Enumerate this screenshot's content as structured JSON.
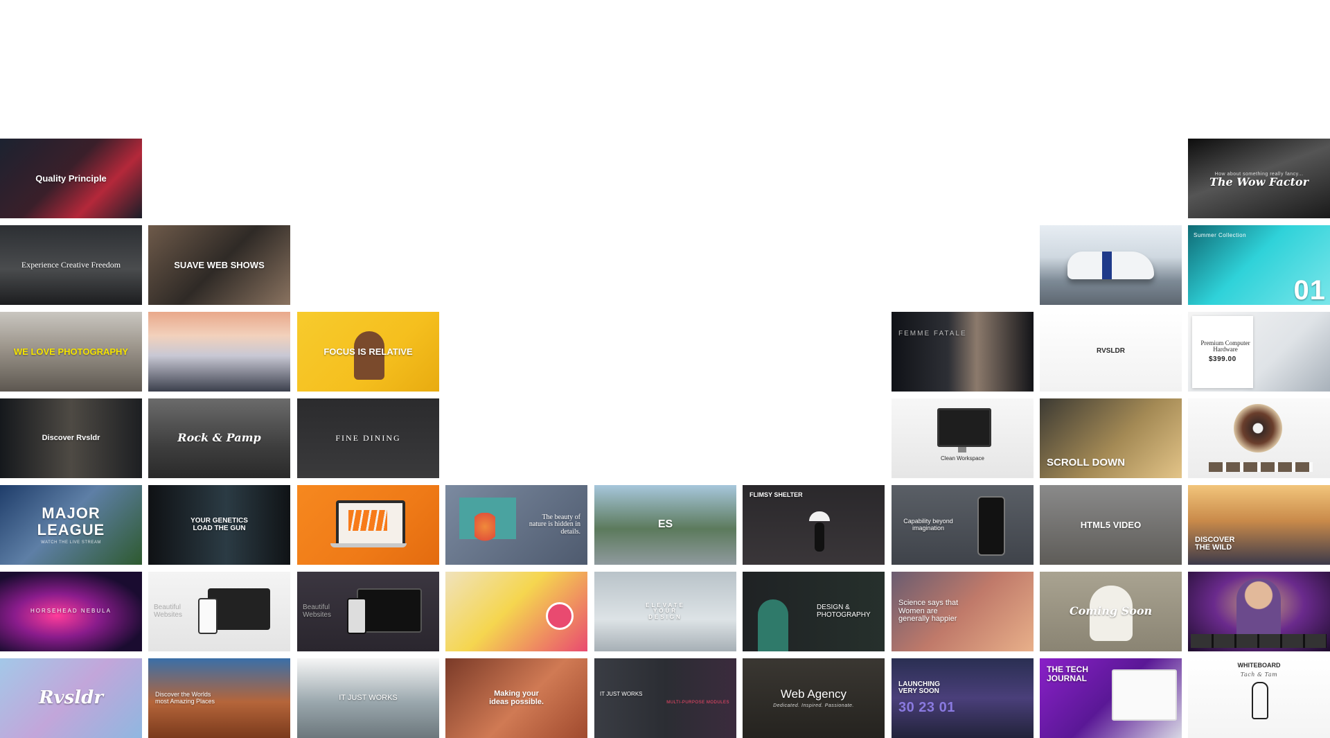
{
  "tiles": [
    {
      "title": "Quality Principle",
      "sub": "",
      "bg": "linear-gradient(135deg,#1c2230 0%,#3a1f2a 45%,#b4283a 70%,#1a1e28 100%)"
    },
    {
      "title": "The Wow Factor",
      "sub": "How about something really fancy...",
      "bg": "linear-gradient(160deg,#0d0d0d 0%,#555 45%,#1a1a1a 100%)",
      "cls": "script"
    },
    {
      "title": "Experience Creative Freedom",
      "sub": "",
      "bg": "linear-gradient(180deg,#2c2f33 0%,#4a4c4e 55%,#1c1d1f 100%)",
      "cls": "serif"
    },
    {
      "title": "SUAVE WEB SHOWS",
      "sub": "",
      "bg": "linear-gradient(135deg,#6e5a4a 0%,#2f2a26 50%,#8a7360 100%)"
    },
    {
      "title": "",
      "sub": "",
      "bg": "linear-gradient(180deg,#e7edf3 0%,#cfd8e0 40%,#7d8a96 70%,#5d6670 100%)"
    },
    {
      "title": "01",
      "sub": "Summer Collection",
      "bg": "linear-gradient(135deg,#0f6a74 0%,#2fd2d9 45%,#7ae6ea 100%)",
      "cls": "big"
    },
    {
      "title": "WE LOVE PHOTOGRAPHY",
      "sub": "",
      "bg": "linear-gradient(180deg,#c9c6c0 0%,#9c958b 45%,#5d5750 100%)",
      "cls": "hi"
    },
    {
      "title": "",
      "sub": "",
      "bg": "linear-gradient(180deg,#e9a88a 0%,#f2d1bc 30%,#c8c8d4 55%,#3b3f4c 100%)"
    },
    {
      "title": "FOCUS IS RELATIVE",
      "sub": "",
      "bg": "linear-gradient(135deg,#f7cb2d 0%,#f5bf1e 60%,#e8ab10 100%)"
    },
    {
      "title": "FEMME FATALE",
      "sub": "",
      "bg": "linear-gradient(90deg,#101217 0%,#2d2f35 40%,#8c7a6c 60%,#131418 100%)",
      "cls": "left"
    },
    {
      "title": "RVSLDR",
      "sub": "",
      "bg": "linear-gradient(180deg,#ffffff 0%,#f2f2f2 100%)",
      "cls": "dark-text"
    },
    {
      "title": "Premium Computer Hardware",
      "sub": "$399.00",
      "bg": "linear-gradient(135deg,#f5f5f5 0%,#dfe3e7 60%,#a8b1ba 100%)",
      "cls": "dark-text serif"
    },
    {
      "title": "Discover Rvsldr",
      "sub": "",
      "bg": "linear-gradient(90deg,#15181c 0%,#4e4a44 50%,#1d1f22 100%)"
    },
    {
      "title": "Rock & Pamp",
      "sub": "",
      "bg": "linear-gradient(180deg,#6b6b6b 0%,#3e3e3e 60%,#2a2a2a 100%)",
      "cls": "script"
    },
    {
      "title": "FINE DINING",
      "sub": "",
      "bg": "linear-gradient(180deg,#2b2b2d 0%,#3a3a3c 100%)",
      "cls": "serif"
    },
    {
      "title": "Clean Workspace",
      "sub": "",
      "bg": "linear-gradient(180deg,#f7f7f7 0%,#e6e6e6 100%)",
      "cls": "dark-text"
    },
    {
      "title": "SCROLL DOWN",
      "sub": "",
      "bg": "linear-gradient(135deg,#3c3a33 0%,#a48a55 55%,#e3c488 100%)",
      "cls": "left"
    },
    {
      "title": "",
      "sub": "",
      "bg": "linear-gradient(180deg,#fafafa 0%,#ececec 100%)"
    },
    {
      "title": "MAJOR LEAGUE",
      "sub": "WATCH THE LIVE STREAM",
      "bg": "linear-gradient(135deg,#1f3d6a 0%,#5e7fa6 45%,#2e5a2f 100%)",
      "cls": "big"
    },
    {
      "title": "YOUR GENETICS LOAD THE GUN",
      "sub": "",
      "bg": "linear-gradient(90deg,#0f1114 0%,#2b3b44 55%,#101316 100%)"
    },
    {
      "title": "",
      "sub": "",
      "bg": "linear-gradient(135deg,#f6881f 0%,#ef7a17 60%,#e36b0f 100%)"
    },
    {
      "title": "The beauty of nature is hidden in details.",
      "sub": "",
      "bg": "linear-gradient(135deg,#7b8aa0 0%,#4e5a6e 100%)",
      "cls": "serif"
    },
    {
      "title": "ES",
      "sub": "",
      "bg": "linear-gradient(180deg,#a7c7dc 0%,#5c7a5c 55%,#8f9a9e 100%)"
    },
    {
      "title": "FLIMSY SHELTER",
      "sub": "",
      "bg": "linear-gradient(180deg,#2a282b 0%,#3a3639 100%)",
      "cls": "left"
    },
    {
      "title": "Capability beyond imagination",
      "sub": "",
      "bg": "linear-gradient(180deg,#5a5f66 0%,#3f434a 100%)"
    },
    {
      "title": "HTML5 VIDEO",
      "sub": "",
      "bg": "linear-gradient(180deg,#8a8a8a 0%,#5e5c58 100%)"
    },
    {
      "title": "DISCOVER THE WILD",
      "sub": "",
      "bg": "linear-gradient(180deg,#f2c57b 0%,#c98a4a 45%,#3c3a4a 100%)",
      "cls": "left"
    },
    {
      "title": "HORSEHEAD NEBULA",
      "sub": "",
      "bg": "radial-gradient(ellipse at 40% 55%,#ff3c9a 0%,#8a1c8c 35%,#1a0c30 75%)"
    },
    {
      "title": "Beautiful Websites",
      "sub": "",
      "bg": "linear-gradient(180deg,#f4f4f4 0%,#e4e4e4 100%)",
      "cls": "dark-text"
    },
    {
      "title": "Beautiful Websites",
      "sub": "",
      "bg": "linear-gradient(180deg,#3b3640 0%,#2a262e 100%)"
    },
    {
      "title": "",
      "sub": "",
      "bg": "linear-gradient(135deg,#f0e2bd 0%,#f5d64f 45%,#e94a70 100%)"
    },
    {
      "title": "ELEVATE YOUR DESIGN",
      "sub": "",
      "bg": "linear-gradient(180deg,#b9c3c9 0%,#dde3e6 60%,#a6afb5 100%)"
    },
    {
      "title": "DESIGN & PHOTOGRAPHY",
      "sub": "",
      "bg": "linear-gradient(90deg,#1f2224 0%,#26302c 100%)"
    },
    {
      "title": "Science says that Women are generally happier",
      "sub": "",
      "bg": "linear-gradient(135deg,#6a5c70 0%,#c07a6a 50%,#e8b08a 100%)",
      "cls": "left"
    },
    {
      "title": "Coming Soon",
      "sub": "",
      "bg": "linear-gradient(180deg,#a9a391 0%,#8a8473 100%)",
      "cls": "script"
    },
    {
      "title": "",
      "sub": "",
      "bg": "radial-gradient(ellipse at 50% 40%,#c9a27e 0%,#6a2a8c 45%,#1c0c2a 100%)"
    },
    {
      "title": "Rvsldr",
      "sub": "",
      "bg": "linear-gradient(135deg,#a3c8e8 0%,#c2a6da 50%,#8fb7e0 100%)",
      "cls": "script"
    },
    {
      "title": "Discover the Worlds most Amazing Places",
      "sub": "",
      "bg": "linear-gradient(180deg,#3a6fa8 0%,#b5653a 55%,#7a3a1c 100%)",
      "cls": "left"
    },
    {
      "title": "IT JUST WORKS",
      "sub": "",
      "bg": "linear-gradient(180deg,#f6f6f6 0%,#9aa7ad 55%,#6c777c 100%)"
    },
    {
      "title": "Making your ideas possible.",
      "sub": "",
      "bg": "linear-gradient(135deg,#7a3a28 0%,#d07a54 55%,#a04a2e 100%)"
    },
    {
      "title": "IT JUST WORKS",
      "sub": "MULTI-PURPOSE MODULES",
      "bg": "linear-gradient(90deg,#3a3d44 0%,#2b2d33 50%,#3b2b3d 100%)"
    },
    {
      "title": "Web Agency",
      "sub": "Dedicated. Inspired. Passionate.",
      "bg": "linear-gradient(180deg,#3a3732 0%,#25231f 100%)"
    },
    {
      "title": "LAUNCHING VERY SOON",
      "sub": "30 23 01",
      "bg": "linear-gradient(180deg,#2a2f52 0%,#4a3f7a 50%,#22233a 100%)",
      "cls": "left"
    },
    {
      "title": "THE TECH JOURNAL",
      "sub": "",
      "bg": "linear-gradient(135deg,#8a20c8 0%,#5a1896 50%,#d8d8e4 100%)",
      "cls": "left"
    },
    {
      "title": "WHITEBOARD",
      "sub": "Tach & Tam",
      "bg": "linear-gradient(180deg,#ffffff 0%,#f4f4f4 100%)",
      "cls": "dark-text"
    }
  ]
}
